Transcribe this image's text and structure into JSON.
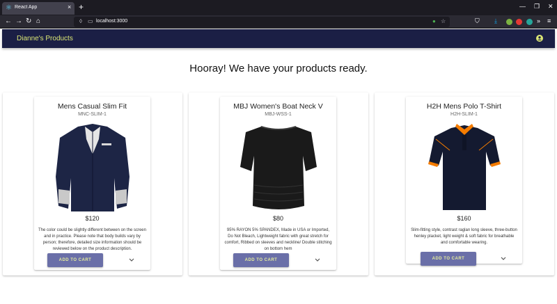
{
  "browser": {
    "tab_title": "React App",
    "tab_close": "×",
    "new_tab": "+",
    "url": "localhost:3000"
  },
  "app": {
    "title": "Dianne's Products",
    "headline": "Hooray! We have your products ready."
  },
  "products": [
    {
      "name": "Mens Casual Slim Fit",
      "sku": "MNC-SLIM-1",
      "price": "$120",
      "description": "The color could be slightly different between on the screen and in practice. Please note that body builds vary by person; therefore, detailed size information should be reviewed below on the product description.",
      "button": "ADD TO CART"
    },
    {
      "name": "MBJ Women's Boat Neck V",
      "sku": "MBJ-WSS-1",
      "price": "$80",
      "description": "95% RAYON 5% SPANDEX, Made in USA or Imported, Do Not Bleach, Lightweight fabric with great stretch for comfort, Ribbed on sleeves and neckline/ Double stitching on bottom hem",
      "button": "ADD TO CART"
    },
    {
      "name": "H2H Mens Polo T-Shirt",
      "sku": "H2H-SLIM-1",
      "price": "$160",
      "description": "Slim-fitting style, contrast raglan long sleeve, three-button henley placket, light weight & soft fabric for breathable and comfortable wearing.",
      "button": "ADD TO CART"
    }
  ],
  "colors": {
    "appbar": "#1b1f45",
    "accent_text": "#dce775",
    "button": "#6a6fa8"
  }
}
